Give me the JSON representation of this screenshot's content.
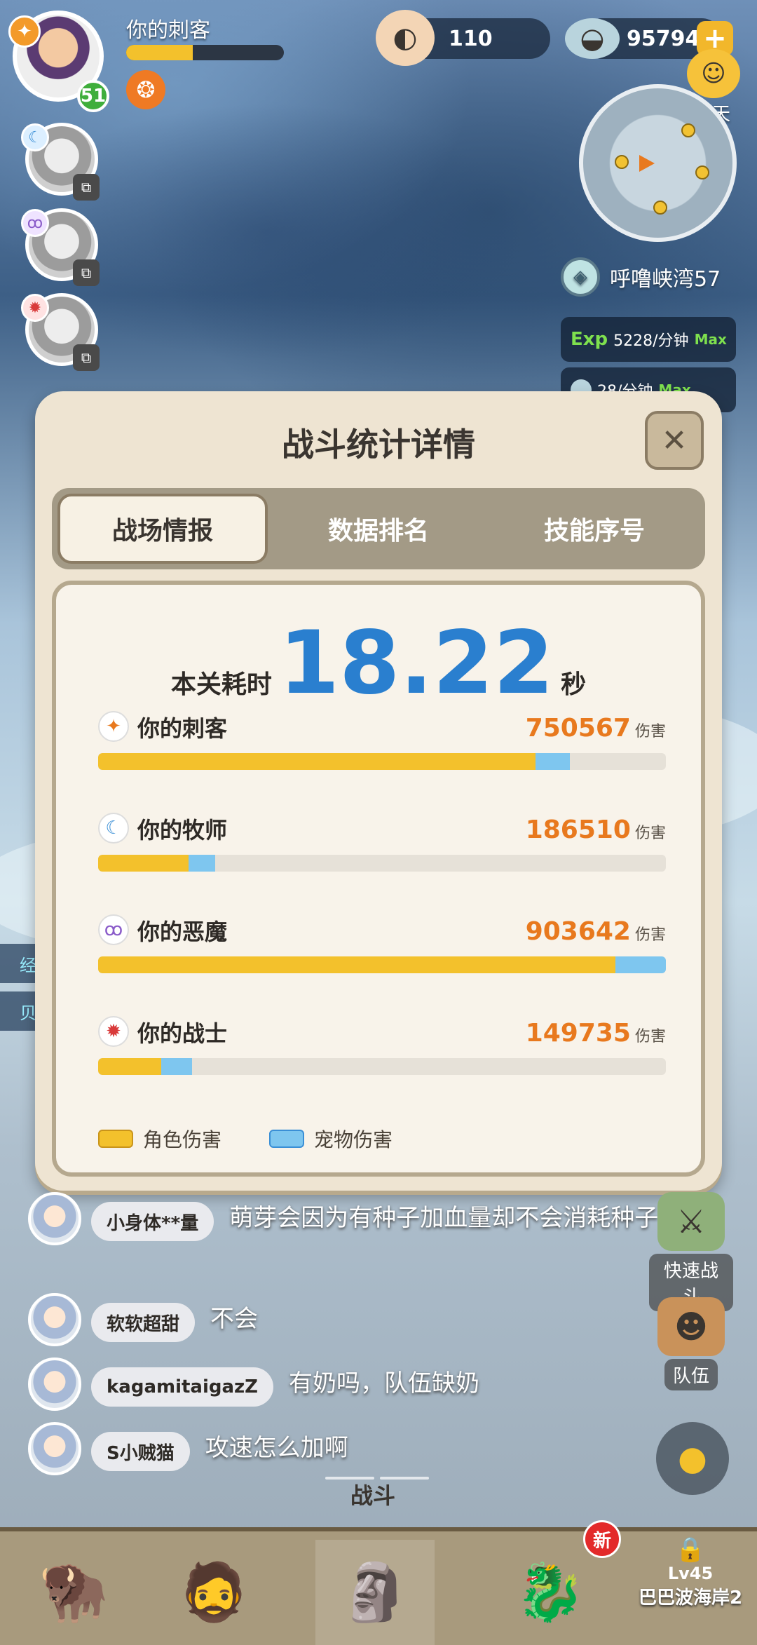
{
  "hud": {
    "player_name": "你的刺客",
    "level": "51",
    "pearls": "110",
    "shells": "95794",
    "chat_label": "聊天",
    "location": "呼噜峡湾57",
    "exp_tag": "Exp",
    "exp_rate": "5228/分钟",
    "exp_max": "Max",
    "rate2": "28/分钟",
    "rate2_max": "Max"
  },
  "side_tags": [
    "经",
    "贝"
  ],
  "panel": {
    "title": "战斗统计详情",
    "close_symbol": "✕",
    "tabs": [
      "战场情报",
      "数据排名",
      "技能序号"
    ],
    "time_label": "本关耗时",
    "time_value": "18.22",
    "time_unit": "秒",
    "damage_unit": "伤害",
    "legend": {
      "character": "角色伤害",
      "pet": "宠物伤害"
    }
  },
  "chart_data": {
    "type": "bar",
    "orientation": "horizontal",
    "stacked": true,
    "categories": [
      "你的刺客",
      "你的牧师",
      "你的恶魔",
      "你的战士"
    ],
    "totals": [
      750567,
      186510,
      903642,
      149735
    ],
    "max": 903642,
    "series": [
      {
        "name": "角色伤害",
        "color": "#f3c12c",
        "values": [
          696000,
          144000,
          823000,
          100000
        ]
      },
      {
        "name": "宠物伤害",
        "color": "#7ec6ef",
        "values": [
          54567,
          42510,
          80642,
          49735
        ]
      }
    ]
  },
  "rows_meta": [
    {
      "icon": "✦",
      "icon_color": "#e8791e"
    },
    {
      "icon": "☾",
      "icon_color": "#3a8fd6"
    },
    {
      "icon": "ꝏ",
      "icon_color": "#8a5bc9"
    },
    {
      "icon": "✹",
      "icon_color": "#d93a3a"
    }
  ],
  "chat": [
    {
      "user": "小身体**量",
      "text": "萌芽会因为有种子加血量却不会消耗种子?"
    },
    {
      "user": "软软超甜",
      "text": "不会"
    },
    {
      "user": "kagamitaigazZ",
      "text": "有奶吗，队伍缺奶"
    },
    {
      "user": "S小贼猫",
      "text": "攻速怎么加啊"
    }
  ],
  "right_buttons": {
    "quick_battle": "快速战斗",
    "team": "队伍"
  },
  "bottom": {
    "battle_label": "战斗",
    "new_badge": "新",
    "locked_level": "Lv45",
    "locked_area": "巴巴波海岸2"
  }
}
